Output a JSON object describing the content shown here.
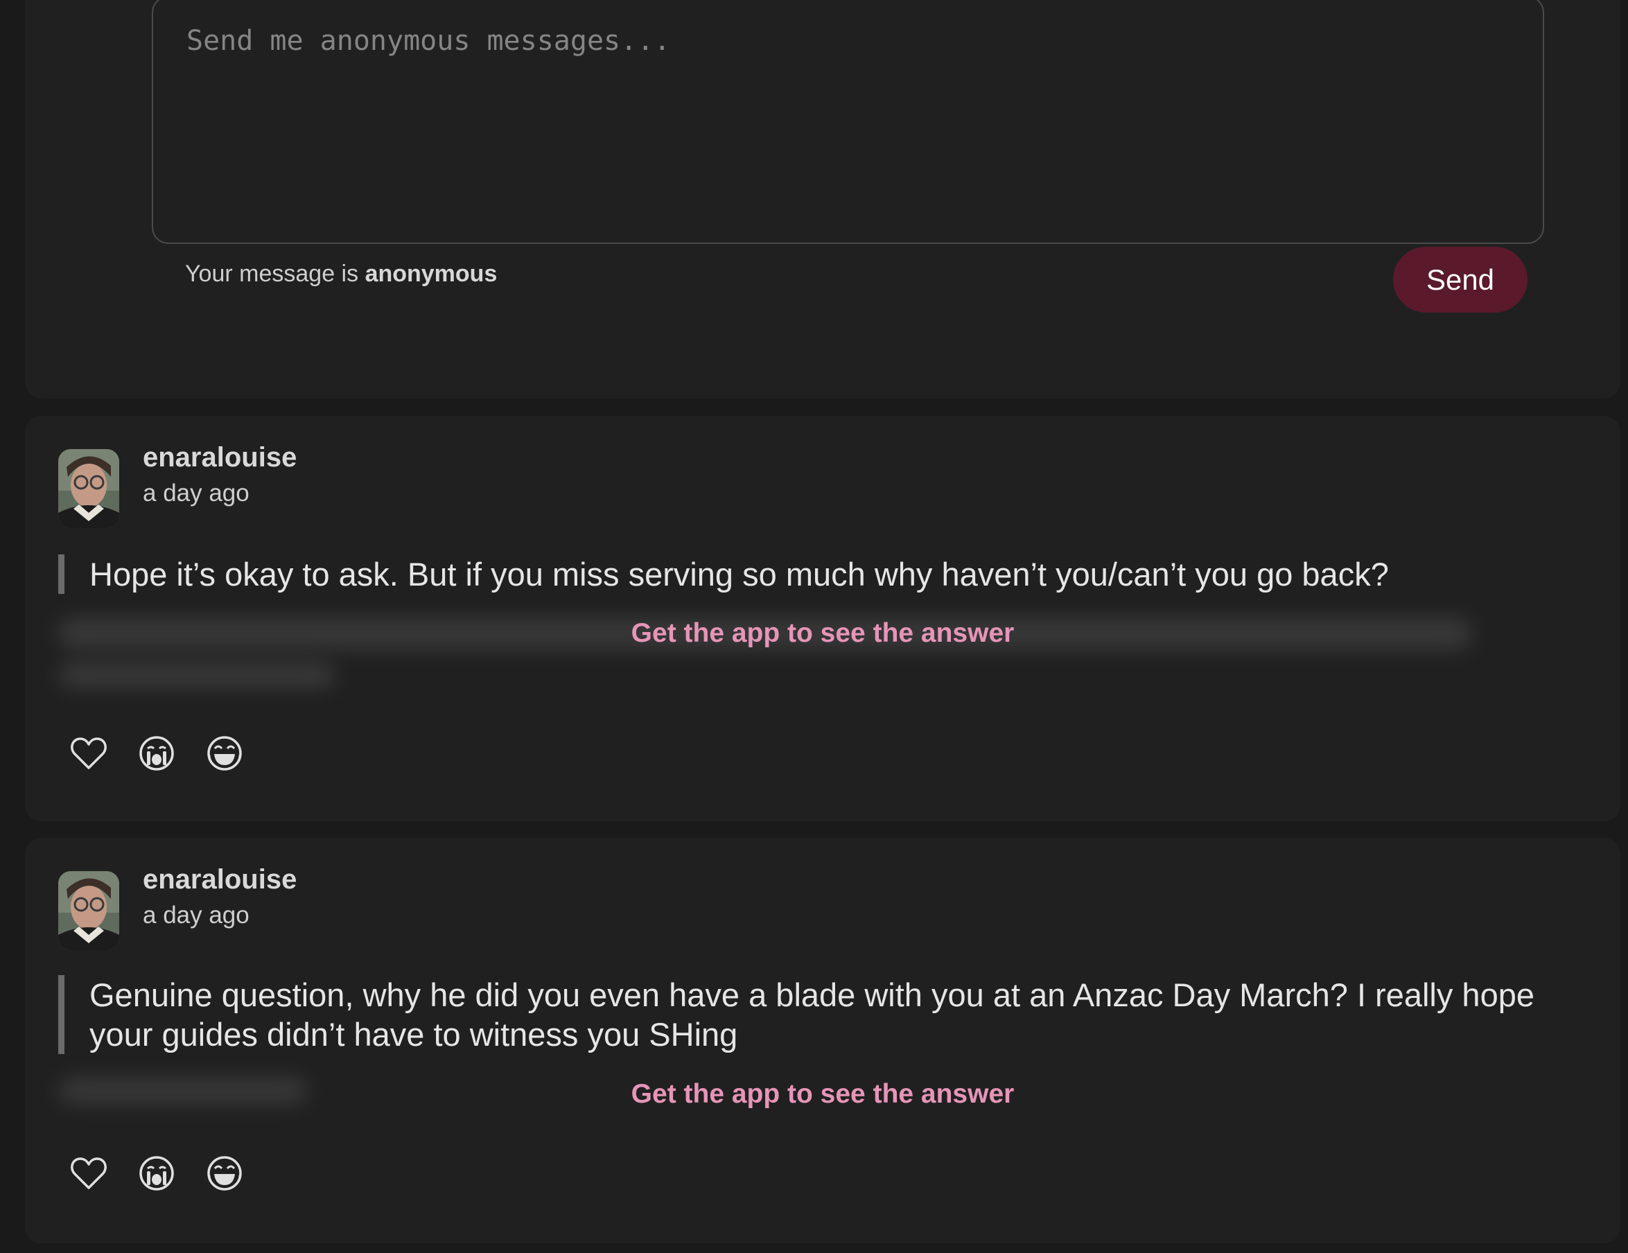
{
  "compose": {
    "placeholder": "Send me anonymous messages...",
    "note_prefix": "Your message is",
    "note_emphasis": "anonymous",
    "send_label": "Send"
  },
  "colors": {
    "background": "#1a1a1a",
    "card": "#202020",
    "accent_button": "#5a1a2c",
    "cta_pink": "#e695b8"
  },
  "questions": [
    {
      "username": "enaralouise",
      "time": "a day ago",
      "text": "Hope it’s okay to ask. But if you miss serving so much why haven’t you/can’t you go back?",
      "answer_cta": "Get the app to see the answer",
      "reactions": [
        "heart-icon",
        "crying-face-icon",
        "laughing-face-icon"
      ]
    },
    {
      "username": "enaralouise",
      "time": "a day ago",
      "text": "Genuine question, why he did you even have a blade with you at an Anzac Day March? I really hope your guides didn’t have to witness you SHing",
      "answer_cta": "Get the app to see the answer",
      "reactions": [
        "heart-icon",
        "crying-face-icon",
        "laughing-face-icon"
      ]
    }
  ]
}
